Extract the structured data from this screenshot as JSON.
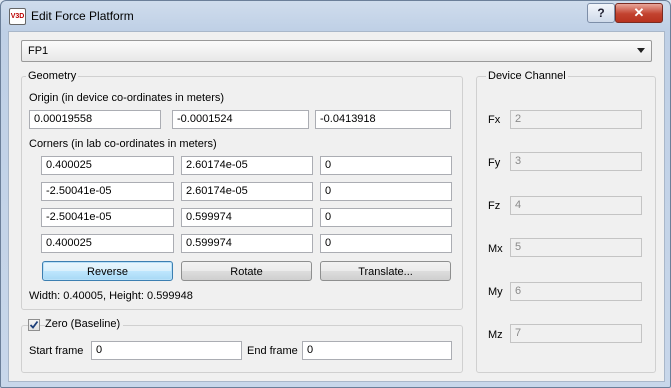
{
  "window": {
    "title": "Edit Force Platform",
    "icon_text": "V3D",
    "help_label": "?",
    "close_label": "✕"
  },
  "platform_select": {
    "value": "FP1"
  },
  "geometry": {
    "title": "Geometry",
    "origin_label": "Origin (in device co-ordinates in meters)",
    "origin": [
      "0.00019558",
      "-0.0001524",
      "-0.0413918"
    ],
    "corners_label": "Corners (in lab co-ordinates in meters)",
    "corners": [
      [
        "0.400025",
        "2.60174e-05",
        "0"
      ],
      [
        "-2.50041e-05",
        "2.60174e-05",
        "0"
      ],
      [
        "-2.50041e-05",
        "0.599974",
        "0"
      ],
      [
        "0.400025",
        "0.599974",
        "0"
      ]
    ],
    "reverse_label": "Reverse",
    "rotate_label": "Rotate",
    "translate_label": "Translate...",
    "size_text": "Width: 0.40005, Height: 0.599948"
  },
  "zero": {
    "label": "Zero (Baseline)",
    "checked": true,
    "start_label": "Start frame",
    "start_value": "0",
    "end_label": "End frame",
    "end_value": "0"
  },
  "device_channel": {
    "title": "Device Channel",
    "channels": [
      {
        "label": "Fx",
        "value": "2"
      },
      {
        "label": "Fy",
        "value": "3"
      },
      {
        "label": "Fz",
        "value": "4"
      },
      {
        "label": "Mx",
        "value": "5"
      },
      {
        "label": "My",
        "value": "6"
      },
      {
        "label": "Mz",
        "value": "7"
      }
    ]
  }
}
